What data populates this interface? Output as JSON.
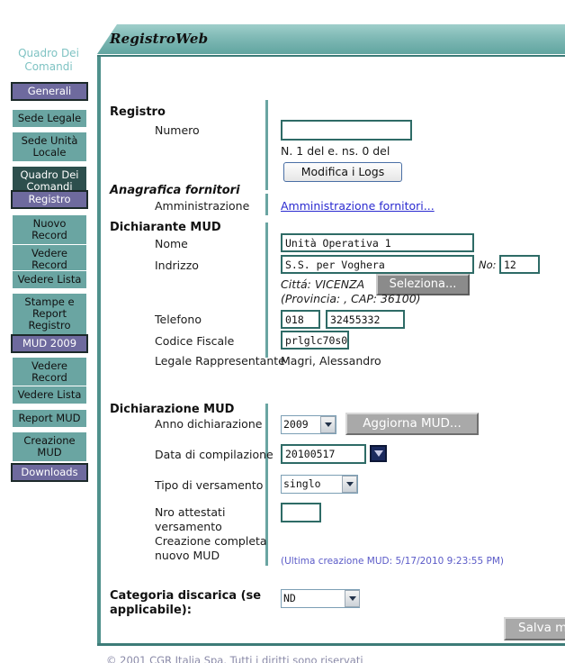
{
  "banner": {
    "title": "RegistroWeb"
  },
  "sidebar": {
    "title": "Quadro Dei Comandi",
    "items": [
      {
        "label": "Generali",
        "state": "selected"
      },
      {
        "label": "Sede Legale",
        "state": "normal"
      },
      {
        "label": "Sede Unità Locale",
        "state": "normal"
      },
      {
        "label": "Quadro Dei Comandi",
        "state": "current"
      },
      {
        "label": "Registro",
        "state": "selected"
      },
      {
        "label": "Nuovo Record",
        "state": "normal"
      },
      {
        "label": "Vedere Record",
        "state": "normal"
      },
      {
        "label": "Vedere Lista",
        "state": "normal"
      },
      {
        "label": "Stampe e Report Registro",
        "state": "normal"
      },
      {
        "label": "MUD 2009",
        "state": "selected"
      },
      {
        "label": "Vedere Record",
        "state": "normal"
      },
      {
        "label": "Vedere Lista",
        "state": "normal"
      },
      {
        "label": "Report MUD",
        "state": "normal"
      },
      {
        "label": "Creazione MUD",
        "state": "normal"
      },
      {
        "label": "Downloads",
        "state": "selected"
      }
    ]
  },
  "sections": {
    "registro": {
      "heading": "Registro",
      "numero_label": "Numero",
      "numero_value": "",
      "summary": "N. 1 del  e. ns. 0 del",
      "modifica_logs_button": "Modifica i Logs"
    },
    "anagrafica": {
      "heading": "Anagrafica fornitori",
      "amministrazione_label": "Amministrazione",
      "amministrazione_link": "Amministrazione fornitori..."
    },
    "dichiarante": {
      "heading": "Dichiarante MUD",
      "nome_label": "Nome",
      "nome_value": "Unità Operativa 1",
      "indrizzo_label": "Indrizzo",
      "indrizzo_value": "S.S. per Voghera",
      "no_label": "No:",
      "no_value": "12",
      "citta_text": "Cittá: VICENZA",
      "seleziona_button": "Seleziona...",
      "provincia_cap_text": "(Provincia: , CAP: 36100)",
      "telefono_label": "Telefono",
      "telefono_prefix": "018",
      "telefono_number": "32455332",
      "codice_fiscale_label": "Codice Fiscale",
      "codice_fiscale_value": "prlglc70s0",
      "legale_label": "Legale Rappresentante",
      "legale_value": "Magri, Alessandro"
    },
    "dichiarazione": {
      "heading": "Dichiarazione MUD",
      "anno_label": "Anno dichiarazione",
      "anno_value": "2009",
      "aggiorna_button": "Aggiorna MUD...",
      "data_label": "Data di compilazione",
      "data_value": "20100517",
      "tipo_label": "Tipo di versamento",
      "tipo_value": "singlo",
      "nro_label": "Nro attestati versamento",
      "nro_value": "",
      "creazione_label": "Creazione completa nuovo MUD",
      "ultima_creazione_note": "(Ultima creazione MUD: 5/17/2010 9:23:55 PM)"
    },
    "categoria": {
      "label": "Categoria discarica (se applicabile):",
      "value": "ND"
    },
    "save_button": "Salva m"
  },
  "footer": {
    "copyright": "© 2001 CGR Italia Spa. Tutti i diritti sono riservati"
  },
  "colors": {
    "teal": "#6aa5a2",
    "dark_teal": "#2d4f4d",
    "purple": "#6e6a9e",
    "link": "#2a2ad0",
    "note": "#5b5bc8"
  }
}
